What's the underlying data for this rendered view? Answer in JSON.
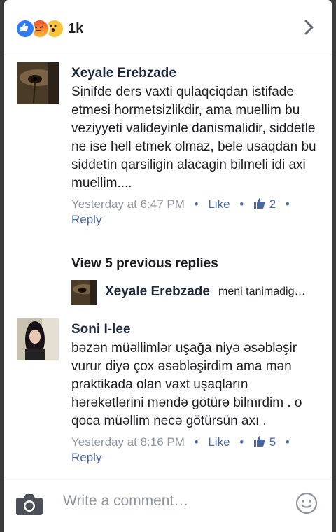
{
  "reactions": {
    "count": "1k",
    "icons": [
      "like-icon",
      "angry-icon",
      "wow-icon"
    ],
    "colors": {
      "like": "#2f7ef7",
      "angry": "#f0522a",
      "wow": "#f7c53c"
    }
  },
  "comments": [
    {
      "author": "Xeyale Erebzade",
      "text": "Sinifde ders vaxti qulaqciqdan istifade etmesi hormetsizlikdir, ama muellim bu veziyyeti valideyinle danismalidir, siddetle ne ise hell etmek olmaz, bele usaqdan bu siddetin qarsiligin alacagin bilmeli idi axi muellim....",
      "time": "Yesterday at 6:47 PM",
      "like_label": "Like",
      "likes": "2",
      "reply_label": "Reply"
    },
    {
      "author": "Soni I-lee",
      "text": "bəzən müəllimlər uşağa niyə əsəbləşir vurur diyə çox əsəbləşirdim ama mən praktikada olan vaxt uşaqların hərəkətlərini məndə götürə bilmrdim . o qoca müəllim necə götürsün axı .",
      "time": "Yesterday at 8:16 PM",
      "like_label": "Like",
      "likes": "5",
      "reply_label": "Reply"
    }
  ],
  "previous_replies": {
    "label": "View 5 previous replies",
    "latest_author": "Xeyale Erebzade",
    "latest_text": "meni tanimadig…"
  },
  "composer": {
    "placeholder": "Write a comment…"
  },
  "colors": {
    "link": "#4b67a1",
    "meta": "#8d949e",
    "author": "#1f2b3c"
  }
}
